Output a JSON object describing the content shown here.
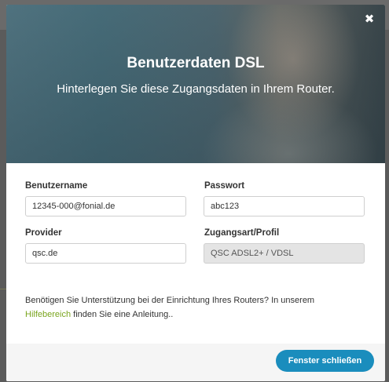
{
  "modal": {
    "close_icon_glyph": "✖",
    "title": "Benutzerdaten DSL",
    "subtitle": "Hinterlegen Sie diese Zugangsdaten in Ihrem Router."
  },
  "form": {
    "username": {
      "label": "Benutzername",
      "value": "12345-000@fonial.de"
    },
    "password": {
      "label": "Passwort",
      "value": "abc123"
    },
    "provider": {
      "label": "Provider",
      "value": "qsc.de"
    },
    "access_type": {
      "label": "Zugangsart/Profil",
      "value": "QSC ADSL2+ / VDSL"
    }
  },
  "help": {
    "text_before": "Benötigen Sie Unterstützung bei der Einrichtung Ihres Routers? In unserem ",
    "link_label": "Hilfebereich",
    "text_after": " finden Sie eine Anleitung.."
  },
  "footer": {
    "close_button_label": "Fenster schließen"
  },
  "colors": {
    "primary_button": "#1a8dbd",
    "link": "#7aa51e"
  }
}
